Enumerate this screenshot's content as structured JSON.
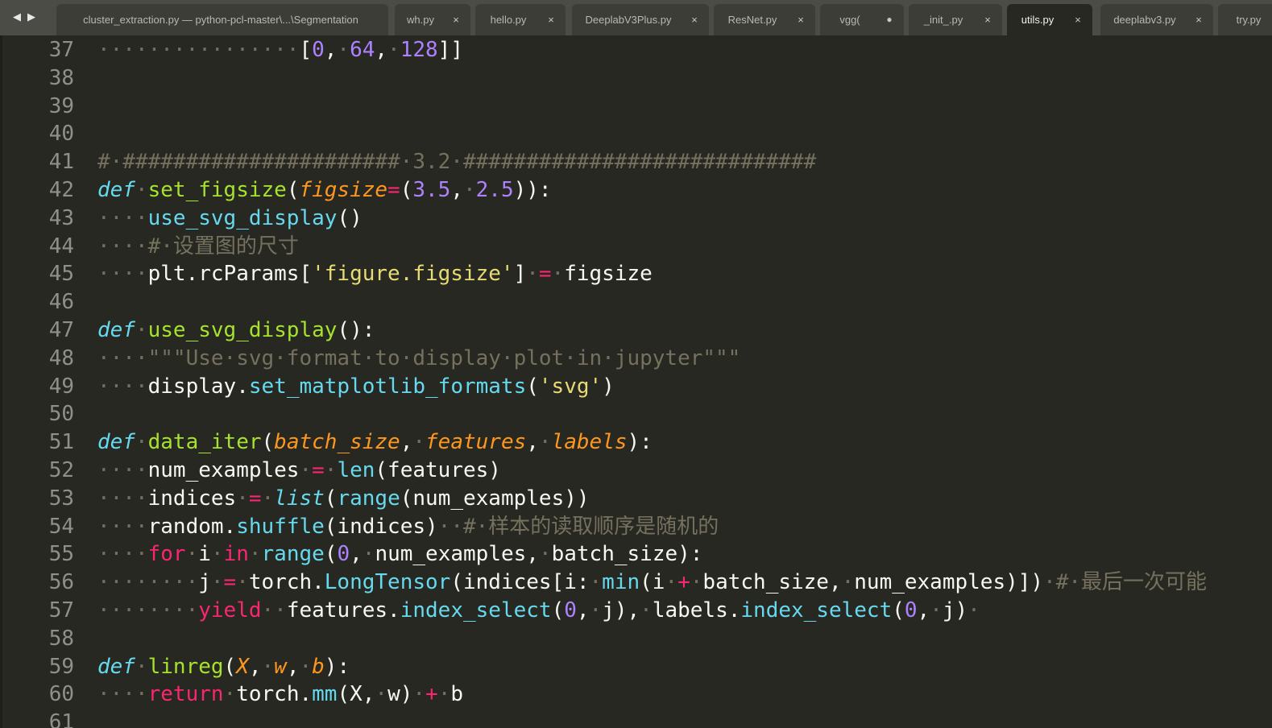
{
  "tabs": [
    {
      "label": "cluster_extraction.py — python-pcl-master\\...\\Segmentation",
      "close": "",
      "active": false
    },
    {
      "label": "wh.py",
      "close": "×",
      "active": false
    },
    {
      "label": "hello.py",
      "close": "×",
      "active": false
    },
    {
      "label": "DeeplabV3Plus.py",
      "close": "×",
      "active": false
    },
    {
      "label": "ResNet.py",
      "close": "×",
      "active": false
    },
    {
      "label": "vgg(",
      "close": "●",
      "active": false
    },
    {
      "label": "_init_.py",
      "close": "×",
      "active": false
    },
    {
      "label": "utils.py",
      "close": "×",
      "active": true
    },
    {
      "label": "deeplabv3.py",
      "close": "×",
      "active": false
    },
    {
      "label": "try.py",
      "close": "",
      "active": false
    }
  ],
  "nav": {
    "prev": "◀",
    "next": "▶"
  },
  "lines": [
    {
      "n": "37",
      "t": [
        [
          "ws",
          "················"
        ],
        [
          "pl",
          "["
        ],
        [
          "num",
          "0"
        ],
        [
          "pl",
          ","
        ],
        [
          "ws",
          "·"
        ],
        [
          "num",
          "64"
        ],
        [
          "pl",
          ","
        ],
        [
          "ws",
          "·"
        ],
        [
          "num",
          "128"
        ],
        [
          "pl",
          "]]"
        ]
      ]
    },
    {
      "n": "38",
      "t": []
    },
    {
      "n": "39",
      "t": []
    },
    {
      "n": "40",
      "t": []
    },
    {
      "n": "41",
      "t": [
        [
          "cmt",
          "#·######################·3.2·############################"
        ]
      ]
    },
    {
      "n": "42",
      "t": [
        [
          "defkw",
          "def"
        ],
        [
          "ws",
          "·"
        ],
        [
          "fn",
          "set_figsize"
        ],
        [
          "pl",
          "("
        ],
        [
          "param",
          "figsize"
        ],
        [
          "op",
          "="
        ],
        [
          "pl",
          "("
        ],
        [
          "num",
          "3.5"
        ],
        [
          "pl",
          ","
        ],
        [
          "ws",
          "·"
        ],
        [
          "num",
          "2.5"
        ],
        [
          "pl",
          "))"
        ],
        [
          "pl",
          ":"
        ]
      ]
    },
    {
      "n": "43",
      "t": [
        [
          "ws",
          "····"
        ],
        [
          "builtin",
          "use_svg_display"
        ],
        [
          "pl",
          "()"
        ]
      ]
    },
    {
      "n": "44",
      "t": [
        [
          "ws",
          "····"
        ],
        [
          "cmt",
          "#·设置图的尺寸"
        ]
      ]
    },
    {
      "n": "45",
      "t": [
        [
          "ws",
          "····"
        ],
        [
          "pl",
          "plt.rcParams["
        ],
        [
          "str",
          "'figure.figsize'"
        ],
        [
          "pl",
          "]"
        ],
        [
          "ws",
          "·"
        ],
        [
          "op",
          "="
        ],
        [
          "ws",
          "·"
        ],
        [
          "pl",
          "figsize"
        ]
      ]
    },
    {
      "n": "46",
      "t": []
    },
    {
      "n": "47",
      "t": [
        [
          "defkw",
          "def"
        ],
        [
          "ws",
          "·"
        ],
        [
          "fn",
          "use_svg_display"
        ],
        [
          "pl",
          "():"
        ]
      ]
    },
    {
      "n": "48",
      "t": [
        [
          "ws",
          "····"
        ],
        [
          "cmt",
          "\"\"\"Use·svg·format·to·display·plot·in·jupyter\"\"\""
        ]
      ]
    },
    {
      "n": "49",
      "t": [
        [
          "ws",
          "····"
        ],
        [
          "pl",
          "display."
        ],
        [
          "builtin",
          "set_matplotlib_formats"
        ],
        [
          "pl",
          "("
        ],
        [
          "str",
          "'svg'"
        ],
        [
          "pl",
          ")"
        ]
      ]
    },
    {
      "n": "50",
      "t": []
    },
    {
      "n": "51",
      "t": [
        [
          "defkw",
          "def"
        ],
        [
          "ws",
          "·"
        ],
        [
          "fn",
          "data_iter"
        ],
        [
          "pl",
          "("
        ],
        [
          "param",
          "batch_size"
        ],
        [
          "pl",
          ","
        ],
        [
          "ws",
          "·"
        ],
        [
          "param",
          "features"
        ],
        [
          "pl",
          ","
        ],
        [
          "ws",
          "·"
        ],
        [
          "param",
          "labels"
        ],
        [
          "pl",
          "):"
        ]
      ]
    },
    {
      "n": "52",
      "t": [
        [
          "ws",
          "····"
        ],
        [
          "pl",
          "num_examples"
        ],
        [
          "ws",
          "·"
        ],
        [
          "op",
          "="
        ],
        [
          "ws",
          "·"
        ],
        [
          "builtin",
          "len"
        ],
        [
          "pl",
          "(features)"
        ]
      ]
    },
    {
      "n": "53",
      "t": [
        [
          "ws",
          "····"
        ],
        [
          "pl",
          "indices"
        ],
        [
          "ws",
          "·"
        ],
        [
          "op",
          "="
        ],
        [
          "ws",
          "·"
        ],
        [
          "cls-it",
          "list"
        ],
        [
          "pl",
          "("
        ],
        [
          "builtin",
          "range"
        ],
        [
          "pl",
          "(num_examples))"
        ]
      ]
    },
    {
      "n": "54",
      "t": [
        [
          "ws",
          "····"
        ],
        [
          "pl",
          "random."
        ],
        [
          "builtin",
          "shuffle"
        ],
        [
          "pl",
          "(indices)"
        ],
        [
          "ws",
          "··"
        ],
        [
          "cmt",
          "#·样本的读取顺序是随机的"
        ]
      ]
    },
    {
      "n": "55",
      "t": [
        [
          "ws",
          "····"
        ],
        [
          "kw",
          "for"
        ],
        [
          "ws",
          "·"
        ],
        [
          "pl",
          "i"
        ],
        [
          "ws",
          "·"
        ],
        [
          "kw",
          "in"
        ],
        [
          "ws",
          "·"
        ],
        [
          "builtin",
          "range"
        ],
        [
          "pl",
          "("
        ],
        [
          "num",
          "0"
        ],
        [
          "pl",
          ","
        ],
        [
          "ws",
          "·"
        ],
        [
          "pl",
          "num_examples,"
        ],
        [
          "ws",
          "·"
        ],
        [
          "pl",
          "batch_size):"
        ]
      ]
    },
    {
      "n": "56",
      "t": [
        [
          "ws",
          "········"
        ],
        [
          "pl",
          "j"
        ],
        [
          "ws",
          "·"
        ],
        [
          "op",
          "="
        ],
        [
          "ws",
          "·"
        ],
        [
          "pl",
          "torch."
        ],
        [
          "builtin",
          "LongTensor"
        ],
        [
          "pl",
          "(indices[i:"
        ],
        [
          "ws",
          "·"
        ],
        [
          "builtin",
          "min"
        ],
        [
          "pl",
          "(i"
        ],
        [
          "ws",
          "·"
        ],
        [
          "op",
          "+"
        ],
        [
          "ws",
          "·"
        ],
        [
          "pl",
          "batch_size,"
        ],
        [
          "ws",
          "·"
        ],
        [
          "pl",
          "num_examples)])"
        ],
        [
          "ws",
          "·"
        ],
        [
          "cmt",
          "#·最后一次可能"
        ]
      ]
    },
    {
      "n": "57",
      "t": [
        [
          "ws",
          "········"
        ],
        [
          "kw",
          "yield"
        ],
        [
          "ws",
          "··"
        ],
        [
          "pl",
          "features."
        ],
        [
          "builtin",
          "index_select"
        ],
        [
          "pl",
          "("
        ],
        [
          "num",
          "0"
        ],
        [
          "pl",
          ","
        ],
        [
          "ws",
          "·"
        ],
        [
          "pl",
          "j),"
        ],
        [
          "ws",
          "·"
        ],
        [
          "pl",
          "labels."
        ],
        [
          "builtin",
          "index_select"
        ],
        [
          "pl",
          "("
        ],
        [
          "num",
          "0"
        ],
        [
          "pl",
          ","
        ],
        [
          "ws",
          "·"
        ],
        [
          "pl",
          "j)"
        ],
        [
          "ws",
          "·"
        ]
      ]
    },
    {
      "n": "58",
      "t": []
    },
    {
      "n": "59",
      "t": [
        [
          "defkw",
          "def"
        ],
        [
          "ws",
          "·"
        ],
        [
          "fn",
          "linreg"
        ],
        [
          "pl",
          "("
        ],
        [
          "param",
          "X"
        ],
        [
          "pl",
          ","
        ],
        [
          "ws",
          "·"
        ],
        [
          "param",
          "w"
        ],
        [
          "pl",
          ","
        ],
        [
          "ws",
          "·"
        ],
        [
          "param",
          "b"
        ],
        [
          "pl",
          "):"
        ]
      ]
    },
    {
      "n": "60",
      "t": [
        [
          "ws",
          "····"
        ],
        [
          "kw",
          "return"
        ],
        [
          "ws",
          "·"
        ],
        [
          "pl",
          "torch."
        ],
        [
          "builtin",
          "mm"
        ],
        [
          "pl",
          "(X,"
        ],
        [
          "ws",
          "·"
        ],
        [
          "pl",
          "w)"
        ],
        [
          "ws",
          "·"
        ],
        [
          "op",
          "+"
        ],
        [
          "ws",
          "·"
        ],
        [
          "pl",
          "b"
        ]
      ]
    },
    {
      "n": "61",
      "t": []
    }
  ]
}
